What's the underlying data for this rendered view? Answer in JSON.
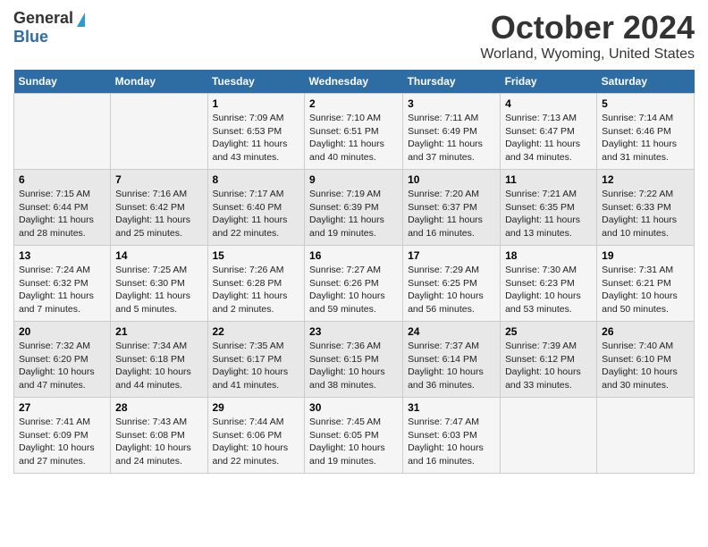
{
  "header": {
    "logo_general": "General",
    "logo_blue": "Blue",
    "month": "October 2024",
    "location": "Worland, Wyoming, United States"
  },
  "days_of_week": [
    "Sunday",
    "Monday",
    "Tuesday",
    "Wednesday",
    "Thursday",
    "Friday",
    "Saturday"
  ],
  "weeks": [
    [
      {
        "day": "",
        "info": ""
      },
      {
        "day": "",
        "info": ""
      },
      {
        "day": "1",
        "info": "Sunrise: 7:09 AM\nSunset: 6:53 PM\nDaylight: 11 hours and 43 minutes."
      },
      {
        "day": "2",
        "info": "Sunrise: 7:10 AM\nSunset: 6:51 PM\nDaylight: 11 hours and 40 minutes."
      },
      {
        "day": "3",
        "info": "Sunrise: 7:11 AM\nSunset: 6:49 PM\nDaylight: 11 hours and 37 minutes."
      },
      {
        "day": "4",
        "info": "Sunrise: 7:13 AM\nSunset: 6:47 PM\nDaylight: 11 hours and 34 minutes."
      },
      {
        "day": "5",
        "info": "Sunrise: 7:14 AM\nSunset: 6:46 PM\nDaylight: 11 hours and 31 minutes."
      }
    ],
    [
      {
        "day": "6",
        "info": "Sunrise: 7:15 AM\nSunset: 6:44 PM\nDaylight: 11 hours and 28 minutes."
      },
      {
        "day": "7",
        "info": "Sunrise: 7:16 AM\nSunset: 6:42 PM\nDaylight: 11 hours and 25 minutes."
      },
      {
        "day": "8",
        "info": "Sunrise: 7:17 AM\nSunset: 6:40 PM\nDaylight: 11 hours and 22 minutes."
      },
      {
        "day": "9",
        "info": "Sunrise: 7:19 AM\nSunset: 6:39 PM\nDaylight: 11 hours and 19 minutes."
      },
      {
        "day": "10",
        "info": "Sunrise: 7:20 AM\nSunset: 6:37 PM\nDaylight: 11 hours and 16 minutes."
      },
      {
        "day": "11",
        "info": "Sunrise: 7:21 AM\nSunset: 6:35 PM\nDaylight: 11 hours and 13 minutes."
      },
      {
        "day": "12",
        "info": "Sunrise: 7:22 AM\nSunset: 6:33 PM\nDaylight: 11 hours and 10 minutes."
      }
    ],
    [
      {
        "day": "13",
        "info": "Sunrise: 7:24 AM\nSunset: 6:32 PM\nDaylight: 11 hours and 7 minutes."
      },
      {
        "day": "14",
        "info": "Sunrise: 7:25 AM\nSunset: 6:30 PM\nDaylight: 11 hours and 5 minutes."
      },
      {
        "day": "15",
        "info": "Sunrise: 7:26 AM\nSunset: 6:28 PM\nDaylight: 11 hours and 2 minutes."
      },
      {
        "day": "16",
        "info": "Sunrise: 7:27 AM\nSunset: 6:26 PM\nDaylight: 10 hours and 59 minutes."
      },
      {
        "day": "17",
        "info": "Sunrise: 7:29 AM\nSunset: 6:25 PM\nDaylight: 10 hours and 56 minutes."
      },
      {
        "day": "18",
        "info": "Sunrise: 7:30 AM\nSunset: 6:23 PM\nDaylight: 10 hours and 53 minutes."
      },
      {
        "day": "19",
        "info": "Sunrise: 7:31 AM\nSunset: 6:21 PM\nDaylight: 10 hours and 50 minutes."
      }
    ],
    [
      {
        "day": "20",
        "info": "Sunrise: 7:32 AM\nSunset: 6:20 PM\nDaylight: 10 hours and 47 minutes."
      },
      {
        "day": "21",
        "info": "Sunrise: 7:34 AM\nSunset: 6:18 PM\nDaylight: 10 hours and 44 minutes."
      },
      {
        "day": "22",
        "info": "Sunrise: 7:35 AM\nSunset: 6:17 PM\nDaylight: 10 hours and 41 minutes."
      },
      {
        "day": "23",
        "info": "Sunrise: 7:36 AM\nSunset: 6:15 PM\nDaylight: 10 hours and 38 minutes."
      },
      {
        "day": "24",
        "info": "Sunrise: 7:37 AM\nSunset: 6:14 PM\nDaylight: 10 hours and 36 minutes."
      },
      {
        "day": "25",
        "info": "Sunrise: 7:39 AM\nSunset: 6:12 PM\nDaylight: 10 hours and 33 minutes."
      },
      {
        "day": "26",
        "info": "Sunrise: 7:40 AM\nSunset: 6:10 PM\nDaylight: 10 hours and 30 minutes."
      }
    ],
    [
      {
        "day": "27",
        "info": "Sunrise: 7:41 AM\nSunset: 6:09 PM\nDaylight: 10 hours and 27 minutes."
      },
      {
        "day": "28",
        "info": "Sunrise: 7:43 AM\nSunset: 6:08 PM\nDaylight: 10 hours and 24 minutes."
      },
      {
        "day": "29",
        "info": "Sunrise: 7:44 AM\nSunset: 6:06 PM\nDaylight: 10 hours and 22 minutes."
      },
      {
        "day": "30",
        "info": "Sunrise: 7:45 AM\nSunset: 6:05 PM\nDaylight: 10 hours and 19 minutes."
      },
      {
        "day": "31",
        "info": "Sunrise: 7:47 AM\nSunset: 6:03 PM\nDaylight: 10 hours and 16 minutes."
      },
      {
        "day": "",
        "info": ""
      },
      {
        "day": "",
        "info": ""
      }
    ]
  ]
}
